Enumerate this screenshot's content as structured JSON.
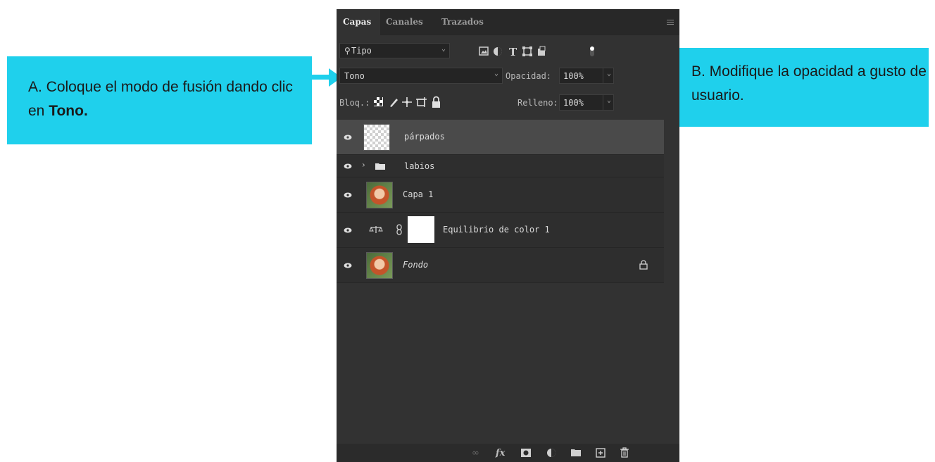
{
  "callout_a": {
    "text": "A. Coloque el modo de fusión dando clic en ",
    "bold": "Tono."
  },
  "callout_b": {
    "text": "B. Modifique la opacidad a gusto de usuario."
  },
  "panel": {
    "tabs": [
      "Capas",
      "Canales",
      "Trazados"
    ],
    "filter": {
      "label": "Tipo"
    },
    "blend_mode": "Tono",
    "opacity_label": "Opacidad:",
    "opacity_value": "100%",
    "lock_label": "Bloq.:",
    "fill_label": "Relleno:",
    "fill_value": "100%",
    "layers": [
      {
        "name": "párpados",
        "selected": true
      },
      {
        "name": "labios"
      },
      {
        "name": "Capa 1"
      },
      {
        "name": "Equilibrio de color 1"
      },
      {
        "name": "Fondo",
        "italic": true,
        "locked": true
      }
    ]
  },
  "colors": {
    "callout": "#1fd0ec",
    "panel": "#323232",
    "selected": "#4a4a4a"
  }
}
